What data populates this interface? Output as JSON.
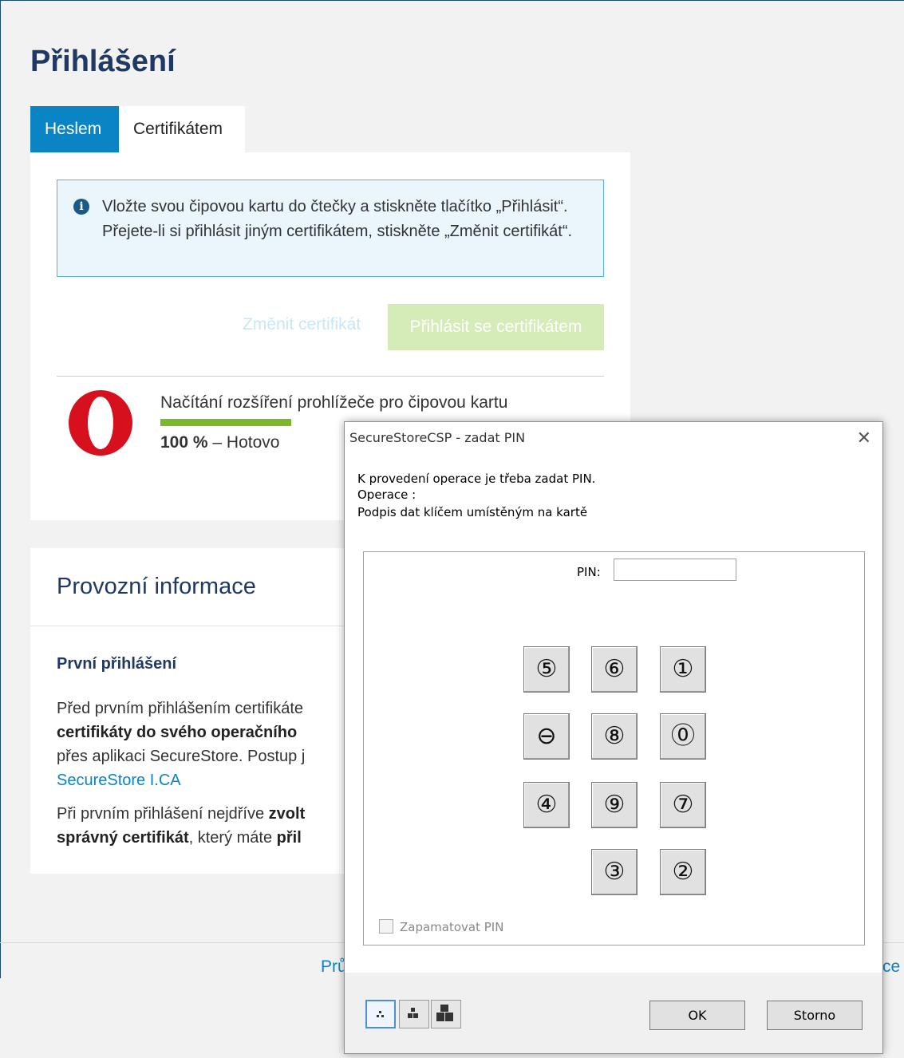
{
  "page": {
    "title": "Přihlášení",
    "tabs": [
      {
        "label": "Heslem",
        "active": true
      },
      {
        "label": "Certifikátem",
        "active": false
      }
    ]
  },
  "login_card": {
    "info_text": "Vložte svou čipovou kartu do čtečky a stiskněte tlačítko „Přihlásit“. Přejete-li si přihlásit jiným certifikátem, stiskněte „Změnit certifikát“.",
    "change_cert_link": "Změnit certifikát",
    "login_button": "Přihlásit se certifikátem",
    "extension_text": "Načítání rozšíření prohlížeče pro čipovou kartu",
    "progress_percent": "100 %",
    "progress_separator": " – ",
    "progress_status": "Hotovo",
    "progress_value": 100
  },
  "info_card": {
    "title": "Provozní informace",
    "first_login_heading": "První přihlášení",
    "para1_a": "Před prvním přihlášením certifikáte",
    "para1_b": "certifikáty do svého operačního",
    "para1_c": "přes aplikaci SecureStore. Postup j",
    "para1_link": "SecureStore I.CA",
    "para2_a": "Při prvním přihlášení nejdříve ",
    "para2_b": "zvolt",
    "para2_c": "správný certifikát",
    "para2_d": ", který máte ",
    "para2_e": "přil"
  },
  "footer": {
    "left": "Prů",
    "right": "ce"
  },
  "dialog": {
    "title": "SecureStoreCSP - zadat PIN",
    "close": "✕",
    "message1": "K provedení operace je třeba zadat PIN.",
    "message2": "Operace :",
    "message3": "Podpis dat klíčem umístěným na kartě",
    "pin_label": "PIN:",
    "pin_value": "",
    "keys": [
      "⑤",
      "⑥",
      "①",
      "⊖",
      "⑧",
      "⓪",
      "④",
      "⑨",
      "⑦",
      "③",
      "②"
    ],
    "remember_label": "Zapamatovat PIN",
    "ok_button": "OK",
    "cancel_button": "Storno"
  }
}
